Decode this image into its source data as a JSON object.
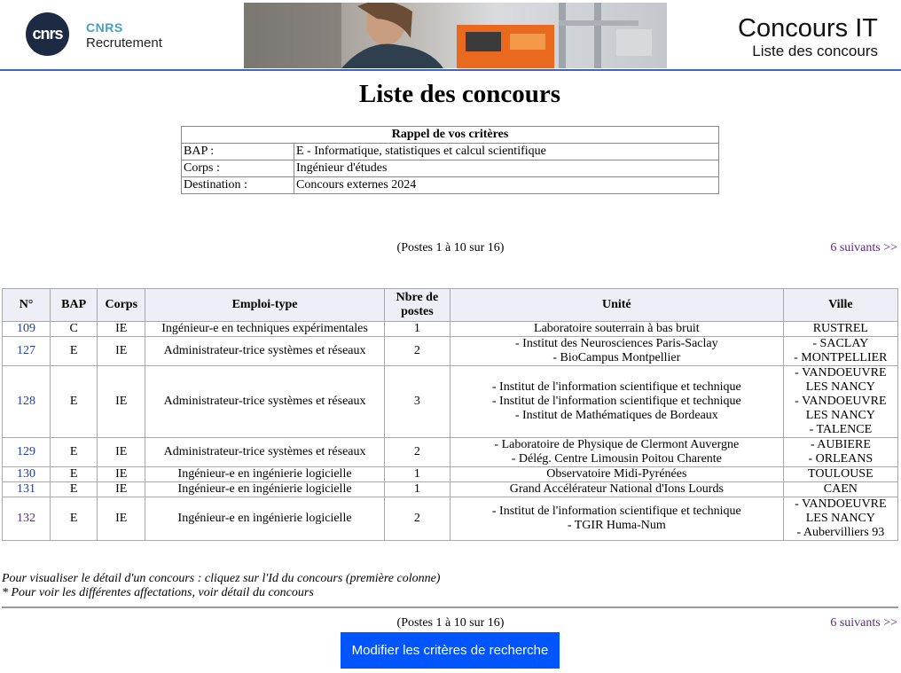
{
  "header": {
    "logo_text": "cnrs",
    "brand_line1": "CNRS",
    "brand_line2": "Recrutement",
    "title": "Concours IT",
    "subtitle": "Liste des concours"
  },
  "page_title": "Liste des concours",
  "criteria": {
    "heading": "Rappel de vos critères",
    "rows": [
      {
        "label": "BAP :",
        "value": "E - Informatique, statistiques et calcul scientifique"
      },
      {
        "label": "Corps :",
        "value": "Ingénieur d'études"
      },
      {
        "label": "Destination :",
        "value": "Concours externes 2024"
      }
    ]
  },
  "pagination": {
    "text": "(Postes 1 à 10 sur 16)",
    "next_label": "6 suivants >>"
  },
  "table": {
    "headers": [
      "N°",
      "BAP",
      "Corps",
      "Emploi-type",
      "Nbre de postes",
      "Unité",
      "Ville"
    ],
    "rows": [
      {
        "id": "109",
        "visited": false,
        "bap": "C",
        "corps": "IE",
        "emploi": "Ingénieur-e en techniques expérimentales",
        "postes": "1",
        "unites": [
          "Laboratoire souterrain à bas bruit"
        ],
        "villes": [
          "RUSTREL"
        ]
      },
      {
        "id": "127",
        "visited": false,
        "bap": "E",
        "corps": "IE",
        "emploi": "Administrateur-trice systèmes et réseaux",
        "postes": "2",
        "unites": [
          "- Institut des Neurosciences Paris-Saclay",
          "- BioCampus Montpellier"
        ],
        "villes": [
          "- SACLAY",
          "- MONTPELLIER"
        ]
      },
      {
        "id": "128",
        "visited": false,
        "bap": "E",
        "corps": "IE",
        "emploi": "Administrateur-trice systèmes et réseaux",
        "postes": "3",
        "unites": [
          "- Institut de l'information scientifique et technique",
          "- Institut de l'information scientifique et technique",
          "- Institut de Mathématiques de Bordeaux"
        ],
        "villes": [
          "- VANDOEUVRE LES NANCY",
          "- VANDOEUVRE LES NANCY",
          "- TALENCE"
        ]
      },
      {
        "id": "129",
        "visited": false,
        "bap": "E",
        "corps": "IE",
        "emploi": "Administrateur-trice systèmes et réseaux",
        "postes": "2",
        "unites": [
          "- Laboratoire de Physique de Clermont Auvergne",
          "- Délég. Centre Limousin Poitou Charente"
        ],
        "villes": [
          "- AUBIERE",
          "- ORLEANS"
        ]
      },
      {
        "id": "130",
        "visited": false,
        "bap": "E",
        "corps": "IE",
        "emploi": "Ingénieur-e en ingénierie logicielle",
        "postes": "1",
        "unites": [
          "Observatoire Midi-Pyrénées"
        ],
        "villes": [
          "TOULOUSE"
        ]
      },
      {
        "id": "131",
        "visited": false,
        "bap": "E",
        "corps": "IE",
        "emploi": "Ingénieur-e en ingénierie logicielle",
        "postes": "1",
        "unites": [
          "Grand Accélérateur National d'Ions Lourds"
        ],
        "villes": [
          "CAEN"
        ]
      },
      {
        "id": "132",
        "visited": true,
        "bap": "E",
        "corps": "IE",
        "emploi": "Ingénieur-e en ingénierie logicielle",
        "postes": "2",
        "unites": [
          "- Institut de l'information scientifique et technique",
          "- TGIR Huma-Num"
        ],
        "villes": [
          "- VANDOEUVRE LES NANCY",
          "- Aubervilliers 93"
        ]
      }
    ]
  },
  "notes": [
    "Pour visualiser le détail d'un concours : cliquez sur l'Id du concours (première colonne)",
    "* Pour voir les différentes affectations, voir détail du concours"
  ],
  "modify_button": "Modifier les critères de recherche",
  "colors": {
    "accent_blue": "#0055ff",
    "link": "#1f3f99",
    "visited_link": "#5a2a82",
    "header_rule": "#3a66c4"
  }
}
